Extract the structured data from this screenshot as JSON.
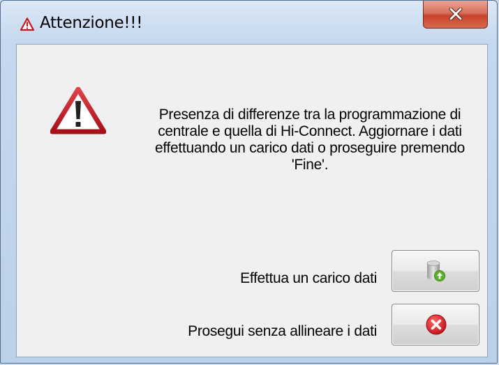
{
  "window": {
    "title": "Attenzione!!!",
    "title_icon": "warning-icon",
    "close_icon": "close-icon"
  },
  "dialog": {
    "icon": "warning-icon",
    "message": "Presenza di differenze tra la programmazione di centrale e quella di Hi-Connect. Aggiornare i dati effettuando un carico dati o proseguire premendo 'Fine'.",
    "options": [
      {
        "label": "Effettua un carico dati",
        "icon": "database-upload-icon"
      },
      {
        "label": "Prosegui senza allineare i dati",
        "icon": "cancel-icon"
      }
    ]
  },
  "colors": {
    "warning_red": "#c4161c",
    "close_red": "#c7432b",
    "cancel_red": "#d8131b",
    "upload_green": "#5fb02c"
  }
}
